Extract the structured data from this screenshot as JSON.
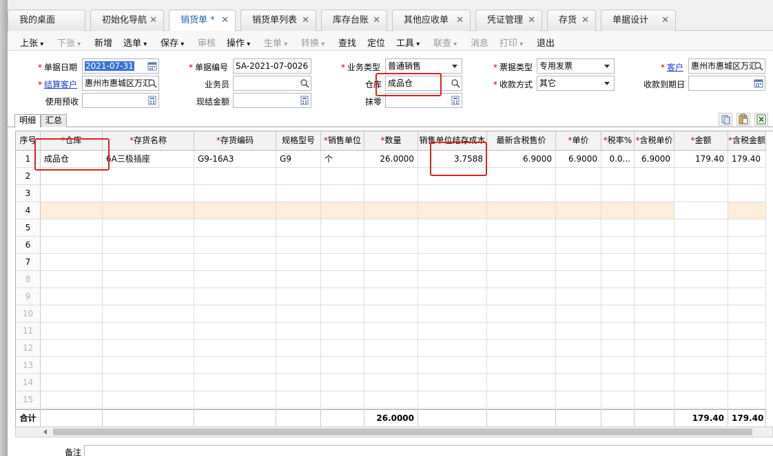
{
  "tabs": [
    {
      "label": "我的桌面",
      "closable": false,
      "active": false
    },
    {
      "label": "初始化导航",
      "closable": true,
      "active": false
    },
    {
      "label": "销货单 *",
      "closable": true,
      "active": true
    },
    {
      "label": "销货单列表",
      "closable": true,
      "active": false
    },
    {
      "label": "库存台账",
      "closable": true,
      "active": false
    },
    {
      "label": "其他应收单",
      "closable": true,
      "active": false
    },
    {
      "label": "凭证管理",
      "closable": true,
      "active": false
    },
    {
      "label": "存货",
      "closable": true,
      "active": false
    },
    {
      "label": "单据设计",
      "closable": true,
      "active": false
    }
  ],
  "close_glyph": "✕",
  "toolbar": [
    {
      "label": "上张",
      "dropdown": true,
      "disabled": false
    },
    {
      "label": "下张",
      "dropdown": true,
      "disabled": true
    },
    {
      "label": "新增",
      "dropdown": false,
      "disabled": false
    },
    {
      "label": "选单",
      "dropdown": true,
      "disabled": false
    },
    {
      "label": "保存",
      "dropdown": true,
      "disabled": false
    },
    {
      "label": "审核",
      "dropdown": false,
      "disabled": true
    },
    {
      "label": "操作",
      "dropdown": true,
      "disabled": false
    },
    {
      "label": "生单",
      "dropdown": true,
      "disabled": true
    },
    {
      "label": "转换",
      "dropdown": true,
      "disabled": true
    },
    {
      "label": "查找",
      "dropdown": false,
      "disabled": false
    },
    {
      "label": "定位",
      "dropdown": false,
      "disabled": false
    },
    {
      "label": "工具",
      "dropdown": true,
      "disabled": false
    },
    {
      "label": "联查",
      "dropdown": true,
      "disabled": true
    },
    {
      "label": "消息",
      "dropdown": false,
      "disabled": true
    },
    {
      "label": "打印",
      "dropdown": true,
      "disabled": true
    },
    {
      "label": "退出",
      "dropdown": false,
      "disabled": false
    }
  ],
  "form": {
    "doc_date": {
      "label": "单据日期",
      "value": "2021-07-31"
    },
    "doc_no": {
      "label": "单据编号",
      "value": "SA-2021-07-0026"
    },
    "biz_type": {
      "label": "业务类型",
      "value": "普通销售"
    },
    "invoice_type": {
      "label": "票据类型",
      "value": "专用发票"
    },
    "customer": {
      "label": "客户",
      "value": "惠州市惠城区万汇"
    },
    "settle_customer": {
      "label": "结算客户",
      "value": "惠州市惠城区万汇"
    },
    "salesman": {
      "label": "业务员",
      "value": ""
    },
    "warehouse": {
      "label": "仓库",
      "value": "成品仓"
    },
    "receive_method": {
      "label": "收款方式",
      "value": "其它"
    },
    "due_date": {
      "label": "收款到期日",
      "value": ""
    },
    "use_prepay": {
      "label": "使用预收",
      "value": ""
    },
    "cash_amount": {
      "label": "现结金额",
      "value": ""
    },
    "write_off": {
      "label": "抹零",
      "value": ""
    }
  },
  "subtabs": [
    "明细",
    "汇总"
  ],
  "grid": {
    "columns": [
      {
        "label": "序号",
        "required": false
      },
      {
        "label": "仓库",
        "required": true
      },
      {
        "label": "存货名称",
        "required": true
      },
      {
        "label": "存货编码",
        "required": true
      },
      {
        "label": "规格型号",
        "required": false
      },
      {
        "label": "销售单位",
        "required": true
      },
      {
        "label": "数量",
        "required": true
      },
      {
        "label": "销售单位结存成本",
        "required": false
      },
      {
        "label": "最新含税售价",
        "required": false
      },
      {
        "label": "单价",
        "required": true
      },
      {
        "label": "税率%",
        "required": true
      },
      {
        "label": "含税单价",
        "required": true
      },
      {
        "label": "金额",
        "required": true
      },
      {
        "label": "含税金额",
        "required": true
      }
    ],
    "rows": [
      {
        "no": "1",
        "cells": [
          "成品仓",
          "6A三极插座",
          "G9-16A3",
          "G9",
          "个",
          "26.0000",
          "3.7588",
          "6.9000",
          "6.9000",
          "0.0...",
          "6.9000",
          "179.40",
          "179.40"
        ]
      },
      {
        "no": "2",
        "cells": []
      },
      {
        "no": "3",
        "cells": []
      },
      {
        "no": "4",
        "cells": []
      },
      {
        "no": "5",
        "cells": []
      },
      {
        "no": "6",
        "cells": []
      },
      {
        "no": "7",
        "cells": []
      },
      {
        "no": "8",
        "cells": []
      },
      {
        "no": "9",
        "cells": []
      },
      {
        "no": "10",
        "cells": []
      },
      {
        "no": "11",
        "cells": []
      },
      {
        "no": "12",
        "cells": []
      },
      {
        "no": "13",
        "cells": []
      },
      {
        "no": "14",
        "cells": []
      },
      {
        "no": "15",
        "cells": []
      }
    ],
    "highlight_row": "4",
    "dim_from": 8,
    "totals": {
      "label": "合计",
      "quantity": "26.0000",
      "amount": "179.40",
      "tax_amount": "179.40"
    }
  },
  "remark_label": "备注",
  "colors": {
    "active_tab_text": "#1a63b7",
    "required": "#cc0000",
    "link": "#1a3cd6",
    "annotation": "#e02020",
    "highlight_row": "#fdeed9"
  }
}
